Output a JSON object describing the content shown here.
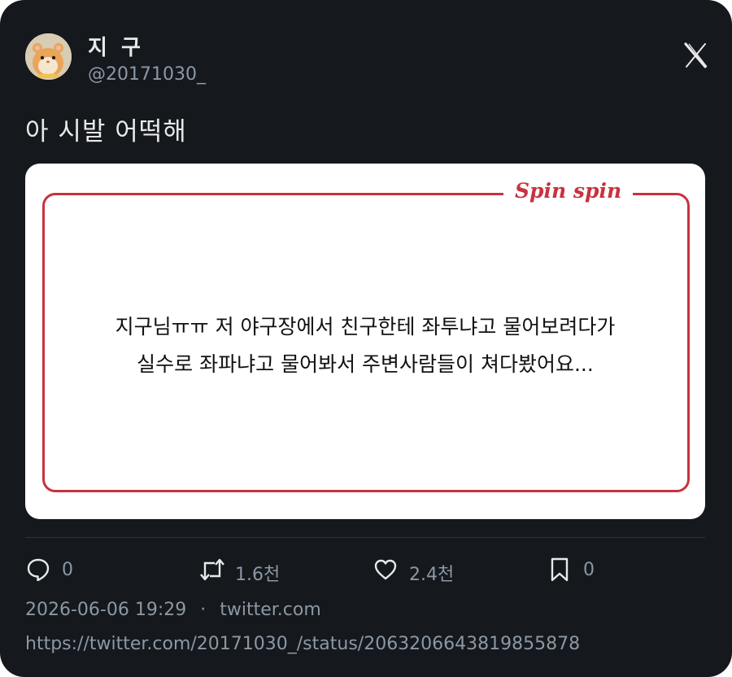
{
  "user": {
    "display_name": "지 구",
    "handle": "@20171030_",
    "avatar_icon": "hamster-avatar"
  },
  "platform_icon": "x-logo-icon",
  "tweet": {
    "text": "아 시발 어떡해"
  },
  "media": {
    "brand": "Spin spin",
    "message_line1": "지구님ㅠㅠ 저 야구장에서 친구한테 좌투냐고 물어보려다가",
    "message_line2": "실수로 좌파냐고 물어봐서 주변사람들이 쳐다봤어요...",
    "accent_color": "#c8323e"
  },
  "actions": {
    "reply": {
      "icon": "reply-icon",
      "count": "0"
    },
    "retweet": {
      "icon": "retweet-icon",
      "count": "1.6천"
    },
    "like": {
      "icon": "heart-icon",
      "count": "2.4천"
    },
    "bookmark": {
      "icon": "bookmark-icon",
      "count": "0"
    }
  },
  "meta": {
    "timestamp": "2026-06-06 19:29",
    "separator": "·",
    "source": "twitter.com",
    "url": "https://twitter.com/20171030_/status/2063206643819855878"
  }
}
